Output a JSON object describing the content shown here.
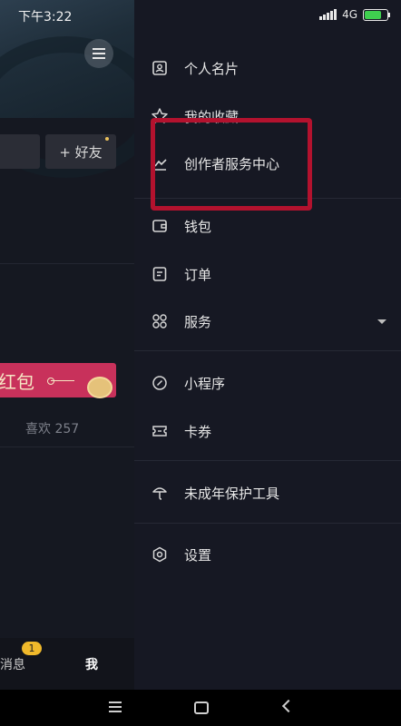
{
  "status_bar": {
    "time": "下午3:22",
    "network": "4G"
  },
  "background_page": {
    "add_friend_label": "+ 好友",
    "red_packet_text": "红包",
    "likes_text": "喜欢 257",
    "tabs": {
      "messages_label": "消息",
      "messages_badge": "1",
      "me_label": "我"
    }
  },
  "drawer": {
    "items": [
      {
        "label": "个人名片",
        "icon": "id-card-icon"
      },
      {
        "label": "我的收藏",
        "icon": "star-icon"
      },
      {
        "label": "创作者服务中心",
        "icon": "chart-line-icon"
      },
      {
        "label": "钱包",
        "icon": "wallet-icon"
      },
      {
        "label": "订单",
        "icon": "order-icon"
      },
      {
        "label": "服务",
        "icon": "grid-icon"
      },
      {
        "label": "小程序",
        "icon": "link-icon"
      },
      {
        "label": "卡券",
        "icon": "ticket-icon"
      },
      {
        "label": "未成年保护工具",
        "icon": "umbrella-icon"
      },
      {
        "label": "设置",
        "icon": "gear-icon"
      }
    ]
  },
  "colors": {
    "highlight": "#b3122e",
    "red_packet": "#c8315b",
    "badge": "#f0b92b"
  }
}
